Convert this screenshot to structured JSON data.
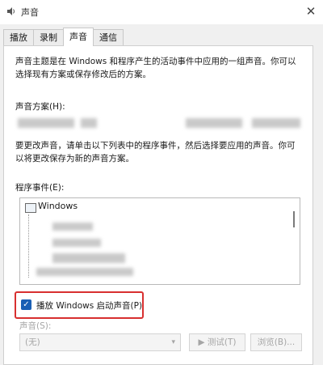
{
  "window": {
    "title": "声音",
    "icon": "speaker-icon",
    "close_glyph": "✕"
  },
  "tabs": [
    {
      "label": "播放",
      "active": false
    },
    {
      "label": "录制",
      "active": false
    },
    {
      "label": "声音",
      "active": true
    },
    {
      "label": "通信",
      "active": false
    }
  ],
  "intro_text": "声音主题是在 Windows 和程序产生的活动事件中应用的一组声音。你可以选择现有方案或保存修改后的方案。",
  "scheme_label": "声音方案(H):",
  "change_text": "要更改声音，请单击以下列表中的程序事件，然后选择要应用的声音。你可以将更改保存为新的声音方案。",
  "events_label": "程序事件(E):",
  "events_list": {
    "items": [
      {
        "label": "Windows"
      }
    ]
  },
  "startup_checkbox": {
    "label": "播放 Windows 启动声音(P)",
    "checked": true,
    "check_glyph": "✓"
  },
  "sound_label": "声音(S):",
  "sound_select_value": "(无)",
  "test_button": "▶ 测试(T)",
  "browse_button": "浏览(B)...",
  "colors": {
    "highlight": "#d83030",
    "checkbox": "#1a5fb4"
  }
}
